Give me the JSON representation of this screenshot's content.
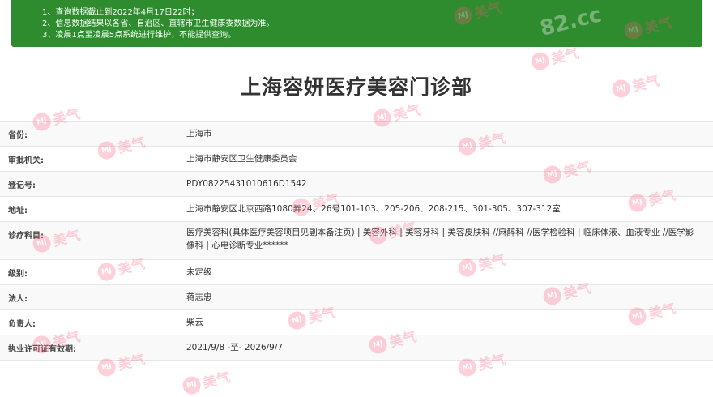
{
  "notice": {
    "lines": [
      "1、查询数据截止到2022年4月17日22时；",
      "2、信息数据结果以各省、自治区、直辖市卫生健康委数据为准。",
      "3、凌晨1点至凌晨5点系统进行维护，不能提供查询。"
    ]
  },
  "title": "上海容妍医疗美容门诊部",
  "rows": [
    {
      "label": "省份:",
      "value": "上海市"
    },
    {
      "label": "审批机关:",
      "value": "上海市静安区卫生健康委员会"
    },
    {
      "label": "登记号:",
      "value": "PDY08225431010616D1542"
    },
    {
      "label": "地址:",
      "value": "上海市静安区北京西路1080弄24、26号101-103、205-206、208-215、301-305、307-312室"
    },
    {
      "label": "诊疗科目:",
      "value": "医疗美容科(具体医疗美容项目见副本备注页) | 美容外科 | 美容牙科 | 美容皮肤科 //麻醉科 //医学检验科 | 临床体液、血液专业 //医学影像科 | 心电诊断专业******"
    },
    {
      "label": "级别:",
      "value": "未定级"
    },
    {
      "label": "法人:",
      "value": "蒋志忠"
    },
    {
      "label": "负责人:",
      "value": "柴云"
    },
    {
      "label": "执业许可证有效期:",
      "value": "2021/9/8 -至- 2026/9/7"
    }
  ],
  "watermark": {
    "logo_text": "MJ",
    "brand_text": "美气",
    "site_text": "82.cc",
    "color": "#ff5a7a"
  },
  "colors": {
    "notice_bg": "#2e8b2e",
    "row_alt_bg": "#f9f9f9",
    "border": "#e6e6e6"
  }
}
